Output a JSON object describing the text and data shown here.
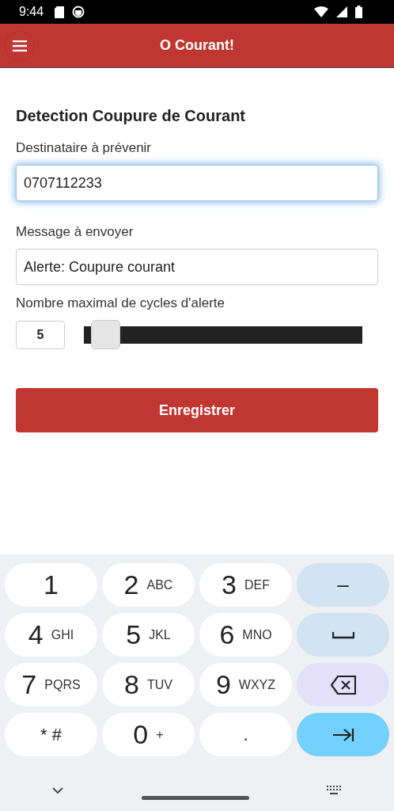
{
  "status_bar": {
    "time": "9:44"
  },
  "app_bar": {
    "title": "O Courant!"
  },
  "form": {
    "heading": "Detection Coupure de Courant",
    "fields": [
      {
        "label": "Destinataire à prévenir",
        "value": "0707112233",
        "focused": true
      },
      {
        "label": "Message à envoyer",
        "value": "Alerte: Coupure courant",
        "focused": false
      }
    ],
    "cycles": {
      "label": "Nombre maximal de cycles d'alerte",
      "value": "5",
      "level": 0.03
    },
    "save_button": "Enregistrer"
  },
  "keyboard": {
    "rows": [
      [
        {
          "kind": "digit",
          "main": "1"
        },
        {
          "kind": "digit",
          "main": "2",
          "sub": "ABC"
        },
        {
          "kind": "digit",
          "main": "3",
          "sub": "DEF"
        },
        {
          "kind": "text",
          "main": "–"
        }
      ],
      [
        {
          "kind": "digit",
          "main": "4",
          "sub": "GHI"
        },
        {
          "kind": "digit",
          "main": "5",
          "sub": "JKL"
        },
        {
          "kind": "digit",
          "main": "6",
          "sub": "MNO"
        },
        {
          "kind": "space"
        }
      ],
      [
        {
          "kind": "digit",
          "main": "7",
          "sub": "PQRS"
        },
        {
          "kind": "digit",
          "main": "8",
          "sub": "TUV"
        },
        {
          "kind": "digit",
          "main": "9",
          "sub": "WXYZ"
        },
        {
          "kind": "backspace"
        }
      ],
      [
        {
          "kind": "small",
          "main": "* #"
        },
        {
          "kind": "digit",
          "main": "0",
          "sub": "+"
        },
        {
          "kind": "small",
          "main": "."
        },
        {
          "kind": "next"
        }
      ]
    ]
  }
}
